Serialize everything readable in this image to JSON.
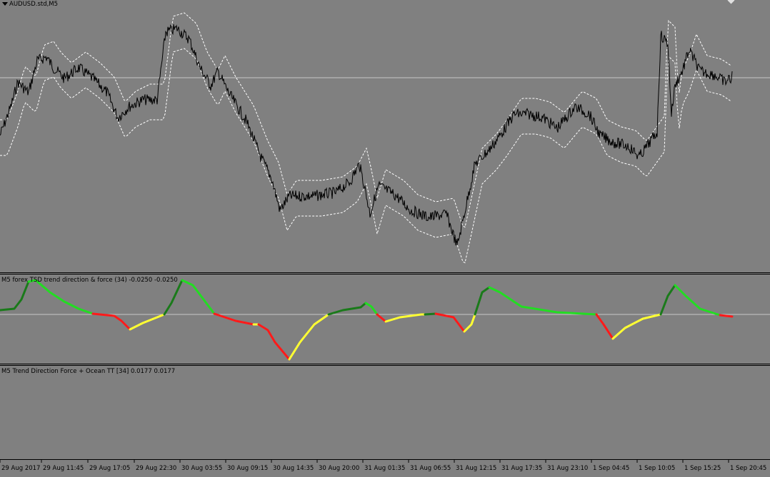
{
  "main_chart": {
    "title": "AUDUSD.std,M5",
    "dropdown_icon": "triangle-down-icon"
  },
  "indicator1": {
    "title": "M5 forex TSD trend direction & force (34) -0.0250 -0.0250"
  },
  "indicator2": {
    "title": "M5 Trend Direction Force + Ocean TT [34] 0.0177 0.0177"
  },
  "time_axis": {
    "labels": [
      "29 Aug 2017",
      "29 Aug 11:45",
      "29 Aug 17:05",
      "29 Aug 22:30",
      "30 Aug 03:55",
      "30 Aug 09:15",
      "30 Aug 14:35",
      "30 Aug 20:00",
      "31 Aug 01:35",
      "31 Aug 06:55",
      "31 Aug 12:15",
      "31 Aug 17:35",
      "31 Aug 23:10",
      "1 Sep 04:45",
      "1 Sep 10:05",
      "1 Sep 15:25",
      "1 Sep 20:45"
    ]
  },
  "colors": {
    "background": "#808080",
    "price": "#000000",
    "bands": "#ffffff",
    "strong_up": "#1a7a1a",
    "weak_up": "#22dd22",
    "weak_down": "#ffff33",
    "strong_down": "#ff1a1a"
  }
}
